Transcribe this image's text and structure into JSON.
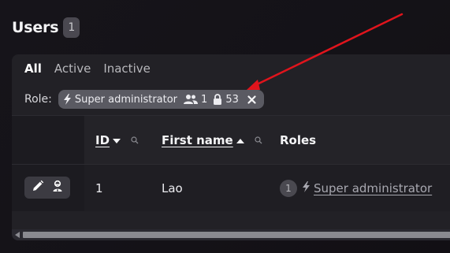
{
  "header": {
    "title": "Users",
    "count": "1"
  },
  "filter_tabs": [
    {
      "label": "All",
      "active": true
    },
    {
      "label": "Active",
      "active": false
    },
    {
      "label": "Inactive",
      "active": false
    }
  ],
  "role_filter": {
    "label": "Role:",
    "chip": {
      "icon": "lightning-icon",
      "name": "Super administrator",
      "users_icon": "users-icon",
      "users_count": "1",
      "lock_icon": "lock-icon",
      "permissions_count": "53",
      "remove_icon": "close-icon"
    }
  },
  "table": {
    "columns": [
      {
        "label": "ID",
        "sort": "descending",
        "filter_icon": "search-icon"
      },
      {
        "label": "First name",
        "sort": "ascending",
        "filter_icon": "search-icon"
      },
      {
        "label": "Roles"
      }
    ],
    "rows": [
      {
        "id": "1",
        "first_name": "Lao",
        "roles_count": "1",
        "role": "Super administrator",
        "actions": [
          "pencil-icon",
          "impersonate-icon"
        ]
      }
    ]
  },
  "annotation": {
    "type": "arrow",
    "color": "#e0141c"
  },
  "colors": {
    "accent_arrow": "#e0141c",
    "chip_bg": "#5a5a62",
    "panel_bg": "#222126"
  }
}
